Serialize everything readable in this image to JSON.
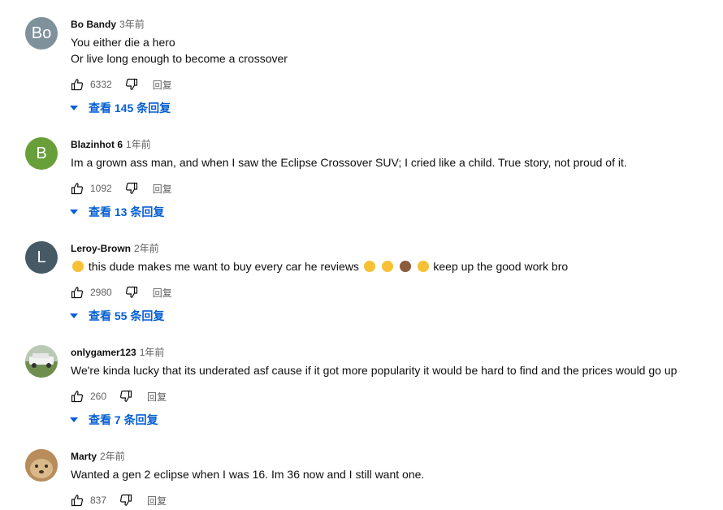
{
  "comments": [
    {
      "author": "Bo Bandy",
      "time": "3年前",
      "avatar_text": "Bo",
      "avatar_color": "#7f919b",
      "lines": [
        "You either die a hero",
        "Or live long enough to become a crossover"
      ],
      "likes": "6332",
      "reply_label": "回复",
      "view_replies": "查看 145 条回复"
    },
    {
      "author": "Blazinhot 6",
      "time": "1年前",
      "avatar_text": "B",
      "avatar_color": "#689f38",
      "lines": [
        "Im a grown ass man, and when I saw the Eclipse Crossover SUV; I cried like a child.  True story, not proud of it."
      ],
      "likes": "1092",
      "reply_label": "回复",
      "view_replies": "查看 13 条回复"
    },
    {
      "author": "Leroy-Brown",
      "time": "2年前",
      "avatar_text": "L",
      "avatar_color": "#455a64",
      "text_before": "this dude makes me want to buy every car he reviews",
      "text_after": "keep up the good work bro",
      "likes": "2980",
      "reply_label": "回复",
      "view_replies": "查看 55 条回复"
    },
    {
      "author": "onlygamer123",
      "time": "1年前",
      "avatar_text": "",
      "avatar_color": "#c9d6c8",
      "lines": [
        "We're kinda lucky that its underated asf cause if it got more popularity it would be hard to find and the prices would go up"
      ],
      "likes": "260",
      "reply_label": "回复",
      "view_replies": "查看 7 条回复"
    },
    {
      "author": "Marty",
      "time": "2年前",
      "avatar_text": "",
      "avatar_color": "#c49a62",
      "lines": [
        "Wanted a gen 2 eclipse when I was 16. Im 36 now and I still want one."
      ],
      "likes": "837",
      "reply_label": "回复"
    }
  ],
  "colors": {
    "link": "#065fd4",
    "meta": "#606060",
    "emoji_laugh": "#f7c136",
    "emoji_fist": "#8d5a3b"
  },
  "icons": {
    "like": "thumb-up-icon",
    "dislike": "thumb-down-icon",
    "expand": "caret-down-icon",
    "emoji": [
      "rolling-laughing-emoji",
      "fist-bump-emoji",
      "steam-face-emoji"
    ]
  }
}
